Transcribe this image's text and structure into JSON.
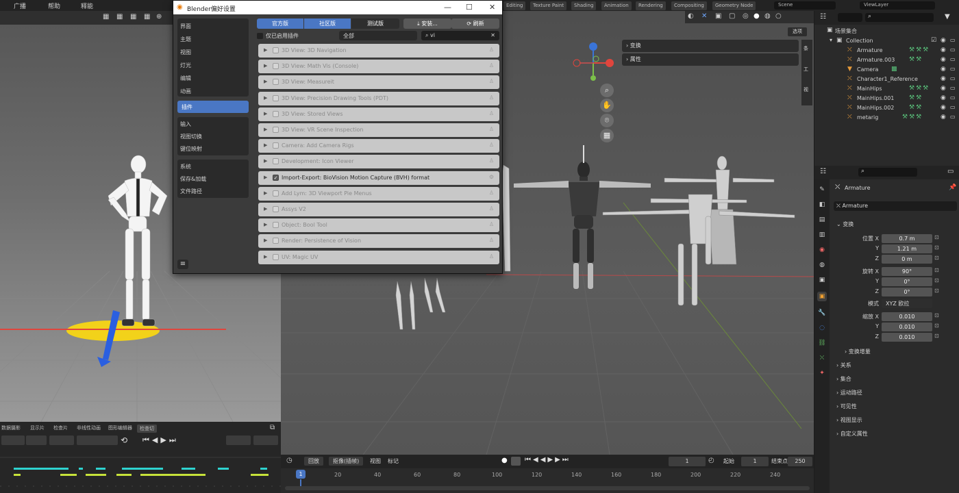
{
  "top_menu": [
    "广播",
    "帮助",
    "释能"
  ],
  "workspace_tabs": [
    "Editing",
    "Texture Paint",
    "Shading",
    "Animation",
    "Rendering",
    "Compositing",
    "Geometry Node"
  ],
  "scene_name": "Scene",
  "view_layer": "ViewLayer",
  "prefs": {
    "title": "Blender偏好设置",
    "nav_group1": [
      "界面",
      "主题",
      "视图",
      "灯光",
      "编辑",
      "动画"
    ],
    "nav_active": "插件",
    "nav_group2": [
      "输入",
      "视图切换",
      "键位映射"
    ],
    "nav_group3": [
      "系统",
      "保存&加载",
      "文件路径"
    ],
    "seg_buttons": [
      "官方版",
      "社区版",
      "测试版"
    ],
    "install_button": "安装...",
    "refresh_button": "刷新",
    "enabled_only_label": "仅已启用插件",
    "category_value": "全部",
    "search_value": "vi",
    "addons": [
      {
        "name": "3D View: 3D Navigation",
        "enabled": false
      },
      {
        "name": "3D View: Math Vis (Console)",
        "enabled": false
      },
      {
        "name": "3D View: Measureit",
        "enabled": false
      },
      {
        "name": "3D View: Precision Drawing Tools (PDT)",
        "enabled": false
      },
      {
        "name": "3D View: Stored Views",
        "enabled": false
      },
      {
        "name": "3D View: VR Scene Inspection",
        "enabled": false
      },
      {
        "name": "Camera: Add Camera Rigs",
        "enabled": false
      },
      {
        "name": "Development: Icon Viewer",
        "enabled": false
      },
      {
        "name": "Import-Export: BioVision Motion Capture (BVH) format",
        "enabled": true
      },
      {
        "name": "Add Lym: 3D Viewport Pie Menus",
        "enabled": false
      },
      {
        "name": "Assys V2",
        "enabled": false
      },
      {
        "name": "Object: Bool Tool",
        "enabled": false
      },
      {
        "name": "Render: Persistence of Vision",
        "enabled": false
      },
      {
        "name": "UV: Magic UV",
        "enabled": false
      }
    ]
  },
  "npanel": {
    "transform": "变换",
    "properties": "属性",
    "view_button": "选项"
  },
  "outliner": {
    "root": "场景集合",
    "collection": "Collection",
    "items": [
      "Armature",
      "Armature.003",
      "Camera",
      "Character1_Reference",
      "MainHips",
      "MainHips.001",
      "MainHips.002",
      "metarig"
    ]
  },
  "properties": {
    "object_name": "Armature",
    "name_field": "Armature",
    "transform_section": "变换",
    "location_label": "位置 X",
    "location": [
      "0.7 m",
      "1.21 m",
      "0 m"
    ],
    "rotation_label": "旋转 X",
    "rotation": [
      "90°",
      "0°",
      "0°"
    ],
    "mode_label": "模式",
    "mode_value": "XYZ 欧拉",
    "scale_label": "缩放 X",
    "scale": [
      "0.010",
      "0.010",
      "0.010"
    ],
    "axis_y": "Y",
    "axis_z": "Z",
    "delta_transform": "变换增量",
    "sections": [
      "关系",
      "集合",
      "运动路径",
      "可见性",
      "视图显示",
      "自定义属性"
    ]
  },
  "left_timeline_tabs": [
    "数据摄影",
    "显示片",
    "检查片",
    "非线性动画",
    "图形编辑器",
    "检查切"
  ],
  "main_timeline": {
    "playback": "回放",
    "keying": "抠像(插帧)",
    "view": "视图",
    "marker": "标记",
    "current_frame": "1",
    "start_label": "起始",
    "start_value": "1",
    "end_label": "结束点",
    "end_value": "250",
    "ticks": [
      "20",
      "40",
      "60",
      "80",
      "100",
      "120",
      "140",
      "160",
      "180",
      "200",
      "220",
      "240"
    ],
    "playhead_label": "1"
  },
  "colors": {
    "accent": "#4a77c4",
    "seg_dark": "#2e2e2e",
    "x_axis": "#e0453d",
    "y_axis": "#7cc04a",
    "z_axis": "#3a74d8"
  }
}
